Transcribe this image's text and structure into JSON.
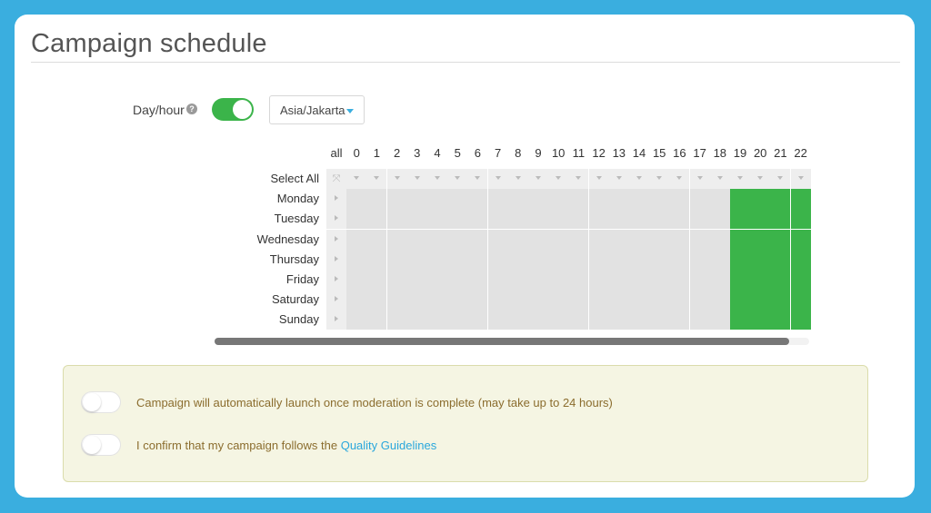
{
  "title": "Campaign schedule",
  "dayhour": {
    "label": "Day/hour",
    "help": "?",
    "enabled": true
  },
  "timezone": {
    "value": "Asia/Jakarta"
  },
  "grid": {
    "all_label": "all",
    "select_all_label": "Select All",
    "hours": [
      "0",
      "1",
      "2",
      "3",
      "4",
      "5",
      "6",
      "7",
      "8",
      "9",
      "10",
      "11",
      "12",
      "13",
      "14",
      "15",
      "16",
      "17",
      "18",
      "19",
      "20",
      "21",
      "22"
    ],
    "days": [
      "Monday",
      "Tuesday",
      "Wednesday",
      "Thursday",
      "Friday",
      "Saturday",
      "Sunday"
    ],
    "selected_hours": [
      19,
      20,
      21,
      22
    ]
  },
  "notice": {
    "auto_launch": {
      "text": "Campaign will automatically launch once moderation is complete (may take up to 24 hours)",
      "enabled": false
    },
    "confirm": {
      "text": "I confirm that my campaign follows the ",
      "link": "Quality Guidelines",
      "enabled": false
    }
  },
  "colors": {
    "background": "#3aaedf",
    "active": "#3bb44a",
    "link": "#2aa7dc",
    "notice_text": "#8b6d2e"
  }
}
